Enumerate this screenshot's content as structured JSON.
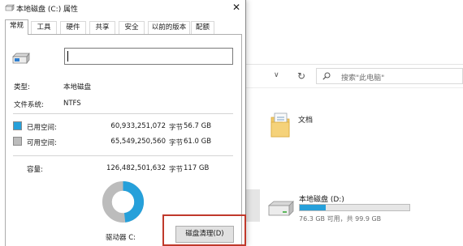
{
  "window": {
    "title": "本地磁盘 (C:) 属性",
    "close_glyph": "✕"
  },
  "tabs": [
    {
      "label": "常规",
      "active": true
    },
    {
      "label": "工具",
      "active": false
    },
    {
      "label": "硬件",
      "active": false
    },
    {
      "label": "共享",
      "active": false
    },
    {
      "label": "安全",
      "active": false
    },
    {
      "label": "以前的版本",
      "active": false
    },
    {
      "label": "配额",
      "active": false
    }
  ],
  "general": {
    "volume_name_value": "",
    "type_label": "类型:",
    "type_value": "本地磁盘",
    "fs_label": "文件系统:",
    "fs_value": "NTFS",
    "used": {
      "label": "已用空间:",
      "bytes": "60,933,251,072",
      "unit": "字节",
      "gb": "56.7 GB",
      "color": "#26a0da"
    },
    "free": {
      "label": "可用空间:",
      "bytes": "65,549,250,560",
      "unit": "字节",
      "gb": "61.0 GB",
      "color": "#bcbcbc"
    },
    "capacity": {
      "label": "容量:",
      "bytes": "126,482,501,632",
      "unit": "字节",
      "gb": "117 GB"
    },
    "drive_caption": "驱动器 C:",
    "cleanup_button": "磁盘清理(D)",
    "highlight_color": "#c0392b"
  },
  "explorer": {
    "address_dropdown_glyph": "∨",
    "refresh_glyph": "↻",
    "search_placeholder": "搜索\"此电脑\"",
    "folder_label": "文档",
    "drive": {
      "label": "本地磁盘 (D:)",
      "free_text": "76.3 GB 可用，共 99.9 GB",
      "used_fraction": 0.236,
      "bar_color": "#26a0da"
    }
  }
}
